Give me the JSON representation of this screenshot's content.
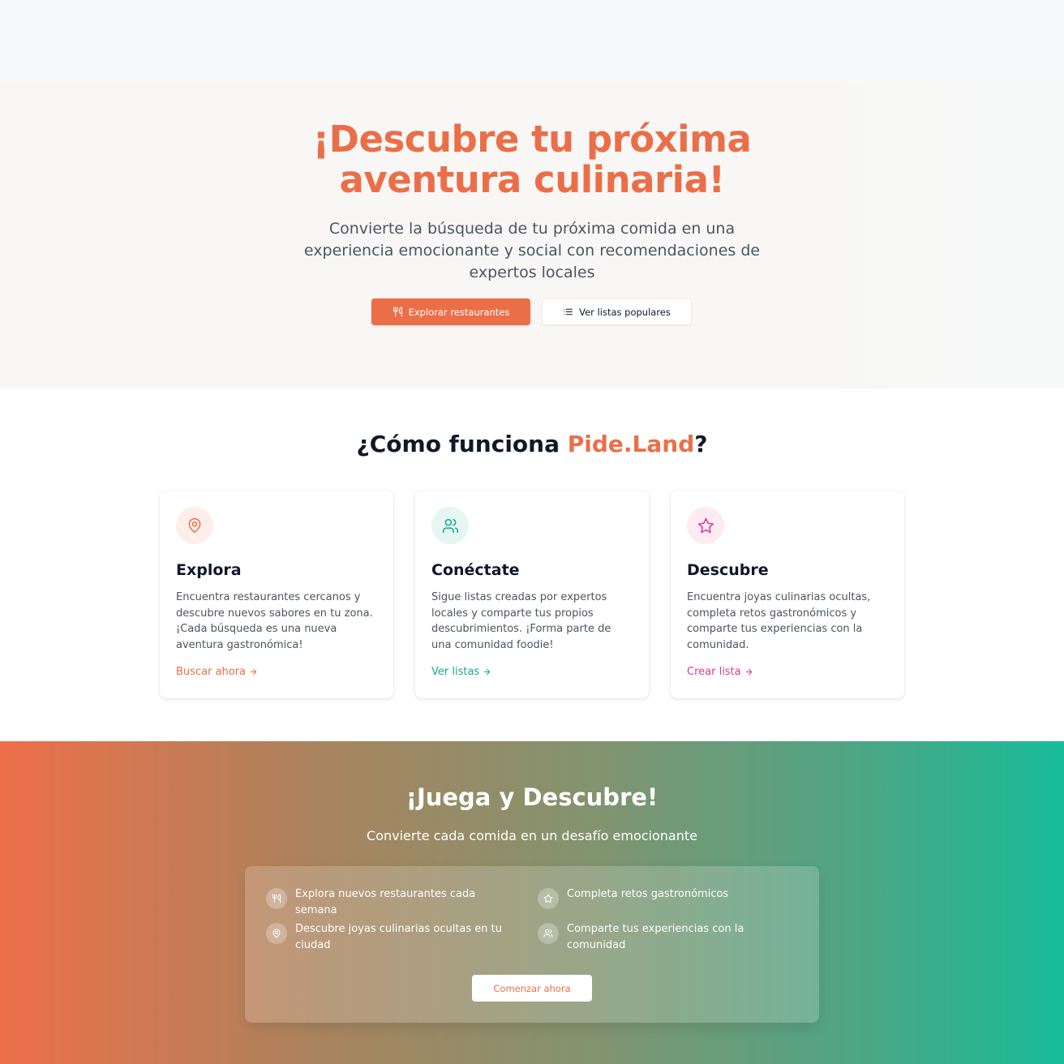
{
  "hero": {
    "title_line1": "¡Descubre tu próxima",
    "title_line2": "aventura culinaria!",
    "subtitle": "Convierte la búsqueda de tu próxima comida en una experiencia emocionante y social con recomendaciones de expertos locales",
    "primary_button": "Explorar restaurantes",
    "secondary_button": "Ver listas populares",
    "primary_icon": "utensils-icon",
    "secondary_icon": "list-icon"
  },
  "how": {
    "title_prefix": "¿Cómo funciona ",
    "title_brand": "Pide.Land",
    "title_suffix": "?",
    "cards": [
      {
        "icon": "map-pin-icon",
        "title": "Explora",
        "description": "Encuentra restaurantes cercanos y descubre nuevos sabores en tu zona. ¡Cada búsqueda es una nueva aventura gastronómica!",
        "link": "Buscar ahora",
        "color": "#ea6f48",
        "icon_bg": "#fdeee9"
      },
      {
        "icon": "users-icon",
        "title": "Conéctate",
        "description": "Sigue listas creadas por expertos locales y comparte tus propios descubrimientos. ¡Forma parte de una comunidad foodie!",
        "link": "Ver listas",
        "color": "#1aa88a",
        "icon_bg": "#e6f6f2"
      },
      {
        "icon": "star-icon",
        "title": "Descubre",
        "description": "Encuentra joyas culinarias ocultas, completa retos gastronómicos y comparte tus experiencias con la comunidad.",
        "link": "Crear lista",
        "color": "#db3a8f",
        "icon_bg": "#fdebf3"
      }
    ]
  },
  "game": {
    "title": "¡Juega y Descubre!",
    "subtitle": "Convierte cada comida en un desafío emocionante",
    "features": [
      {
        "icon": "utensils-icon",
        "text": "Explora nuevos restaurantes cada semana"
      },
      {
        "icon": "star-icon",
        "text": "Completa retos gastronómicos"
      },
      {
        "icon": "map-pin-icon",
        "text": "Descubre joyas culinarias ocultas en tu ciudad"
      },
      {
        "icon": "users-icon",
        "text": "Comparte tus experiencias con la comunidad"
      }
    ],
    "button": "Comenzar ahora"
  }
}
